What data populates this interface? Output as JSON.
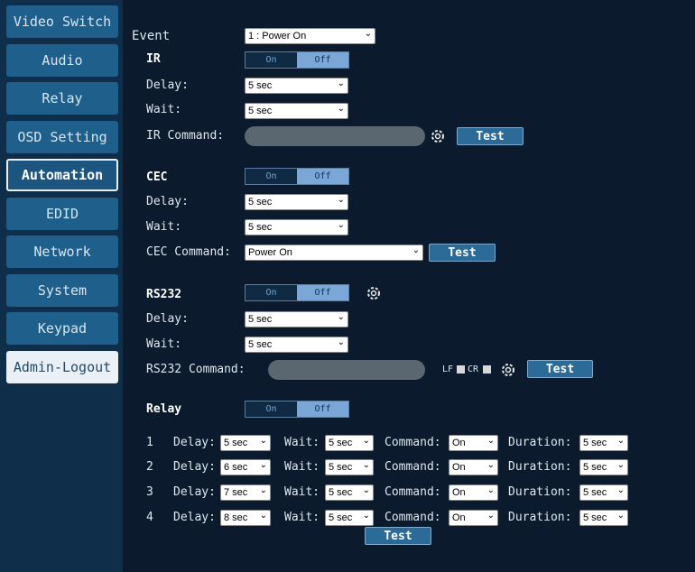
{
  "sidebar": {
    "items": [
      "Video Switch",
      "Audio",
      "Relay",
      "OSD Setting",
      "Automation",
      "EDID",
      "Network",
      "System",
      "Keypad",
      "Admin-Logout"
    ],
    "active": "Automation"
  },
  "event": {
    "label": "Event",
    "value": "1 : Power On"
  },
  "toggle": {
    "on": "On",
    "off": "Off"
  },
  "ir": {
    "title": "IR",
    "delay_label": "Delay:",
    "delay": "5 sec",
    "wait_label": "Wait:",
    "wait": "5 sec",
    "command_label": "IR Command:",
    "test": "Test"
  },
  "cec": {
    "title": "CEC",
    "delay_label": "Delay:",
    "delay": "5 sec",
    "wait_label": "Wait:",
    "wait": "5 sec",
    "command_label": "CEC Command:",
    "command": "Power On",
    "test": "Test"
  },
  "rs232": {
    "title": "RS232",
    "delay_label": "Delay:",
    "delay": "5 sec",
    "wait_label": "Wait:",
    "wait": "5 sec",
    "command_label": "RS232 Command:",
    "lf": "LF",
    "cr": "CR",
    "test": "Test"
  },
  "relay": {
    "title": "Relay",
    "delay_label": "Delay:",
    "wait_label": "Wait:",
    "command_label": "Command:",
    "duration_label": "Duration:",
    "rows": [
      {
        "n": "1",
        "delay": "5 sec",
        "wait": "5 sec",
        "command": "On",
        "duration": "5 sec"
      },
      {
        "n": "2",
        "delay": "6 sec",
        "wait": "5 sec",
        "command": "On",
        "duration": "5 sec"
      },
      {
        "n": "3",
        "delay": "7 sec",
        "wait": "5 sec",
        "command": "On",
        "duration": "5 sec"
      },
      {
        "n": "4",
        "delay": "8 sec",
        "wait": "5 sec",
        "command": "On",
        "duration": "5 sec"
      }
    ],
    "test": "Test"
  }
}
